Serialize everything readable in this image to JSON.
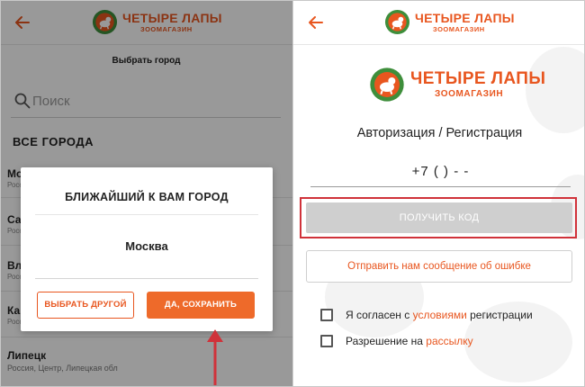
{
  "brand": {
    "name": "ЧЕТЫРЕ ЛАПЫ",
    "subtitle": "ЗООМАГАЗИН",
    "accent_color": "#e8561f",
    "logo_green": "#3e8e3b"
  },
  "left_screen": {
    "header": {
      "back_icon": "arrow-left-icon"
    },
    "choose_city_label": "Выбрать город",
    "search": {
      "placeholder": "Поиск",
      "icon": "search-icon"
    },
    "all_cities_label": "ВСЕ ГОРОДА",
    "cities": [
      {
        "name": "Мо",
        "region": "Росс"
      },
      {
        "name": "Са",
        "region": "Росс"
      },
      {
        "name": "Вл",
        "region": "Росс"
      },
      {
        "name": "Ка",
        "region": "Росс"
      },
      {
        "name": "Липецк",
        "region": "Россия, Центр, Липецкая обл"
      }
    ],
    "dialog": {
      "title": "БЛИЖАЙШИЙ К ВАМ ГОРОД",
      "city": "Москва",
      "choose_other_label": "ВЫБРАТЬ ДРУГОЙ",
      "save_label": "ДА, СОХРАНИТЬ"
    }
  },
  "right_screen": {
    "header": {
      "back_icon": "arrow-left-icon"
    },
    "auth_title": "Авторизация / Регистрация",
    "phone_value": "+7 (  )  - -",
    "get_code_label": "ПОЛУЧИТЬ КОД",
    "report_error_label": "Отправить нам сообщение об ошибке",
    "terms": {
      "prefix": "Я согласен с ",
      "link": "условиями",
      "suffix": " регистрации",
      "checked": false
    },
    "newsletter": {
      "prefix": "Разрешение на ",
      "link": "рассылку",
      "checked": false
    }
  }
}
